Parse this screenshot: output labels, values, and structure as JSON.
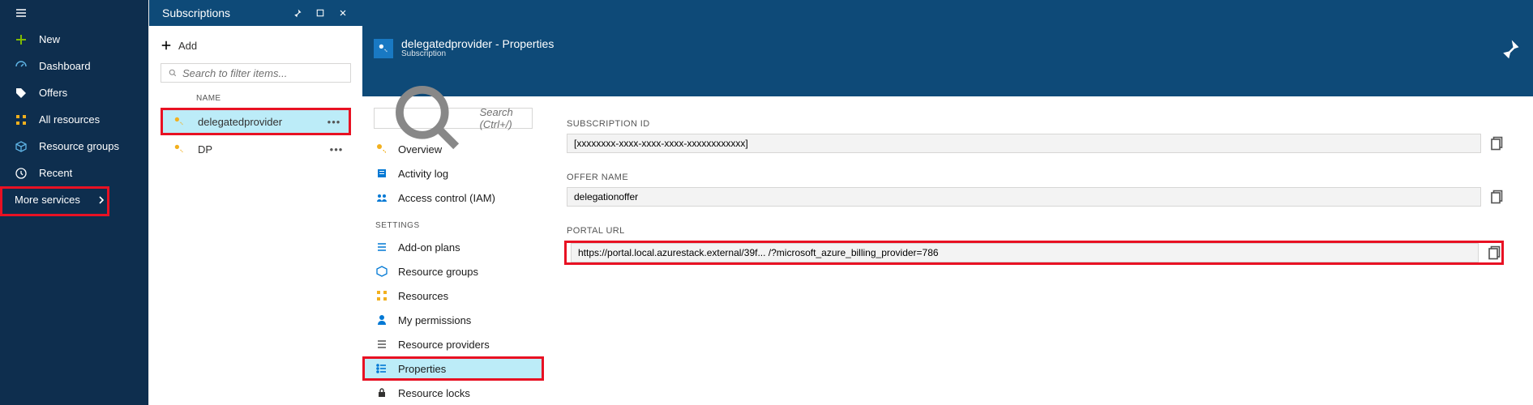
{
  "leftnav": {
    "new": "New",
    "dashboard": "Dashboard",
    "offers": "Offers",
    "all_resources": "All resources",
    "resource_groups": "Resource groups",
    "recent": "Recent",
    "more_services": "More services"
  },
  "subs_blade": {
    "title": "Subscriptions",
    "add_label": "Add",
    "filter_placeholder": "Search to filter items...",
    "col_name": "NAME",
    "rows": [
      {
        "name": "delegatedprovider"
      },
      {
        "name": "DP"
      }
    ]
  },
  "props_blade": {
    "title_main": "delegatedprovider - Properties",
    "title_sub": "Subscription",
    "search_placeholder": "Search (Ctrl+/)",
    "items": {
      "overview": "Overview",
      "activity_log": "Activity log",
      "access_control": "Access control (IAM)",
      "settings_label": "SETTINGS",
      "addon_plans": "Add-on plans",
      "resource_groups": "Resource groups",
      "resources": "Resources",
      "my_permissions": "My permissions",
      "resource_providers": "Resource providers",
      "properties": "Properties",
      "resource_locks": "Resource locks"
    }
  },
  "detail": {
    "subscription_id_label": "SUBSCRIPTION ID",
    "subscription_id_value": "[xxxxxxxx-xxxx-xxxx-xxxx-xxxxxxxxxxxx]",
    "offer_name_label": "OFFER NAME",
    "offer_name_value": "delegationoffer",
    "portal_url_label": "PORTAL URL",
    "portal_url_value": "https://portal.local.azurestack.external/39f...                                                  /?microsoft_azure_billing_provider=786"
  }
}
